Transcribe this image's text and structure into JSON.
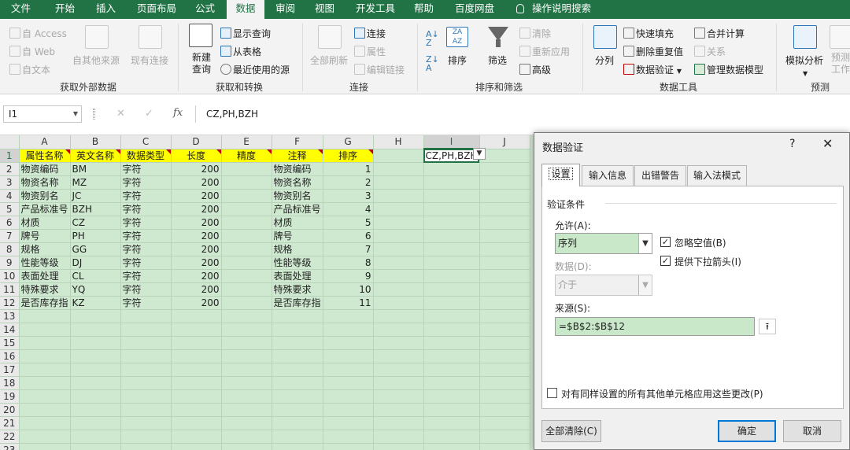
{
  "tabs": [
    "文件",
    "开始",
    "插入",
    "页面布局",
    "公式",
    "数据",
    "审阅",
    "视图",
    "开发工具",
    "帮助",
    "百度网盘",
    "操作说明搜索"
  ],
  "ribbon": {
    "groups": {
      "external": {
        "label": "获取外部数据",
        "items": [
          "自 Access",
          "自 Web",
          "自文本"
        ],
        "other_sources": "自其他来源",
        "existing": "现有连接"
      },
      "transform": {
        "label": "获取和转换",
        "new_query": "新建\n查询",
        "new_query_l1": "新建",
        "new_query_l2": "查询",
        "items": [
          "显示查询",
          "从表格",
          "最近使用的源"
        ]
      },
      "connections": {
        "label": "连接",
        "refresh_all": "全部刷新",
        "items": [
          "连接",
          "属性",
          "编辑链接"
        ]
      },
      "sort_filter": {
        "label": "排序和筛选",
        "sort": "排序",
        "filter": "筛选",
        "items": [
          "清除",
          "重新应用",
          "高级"
        ]
      },
      "data_tools": {
        "label": "数据工具",
        "split": "分列",
        "items": [
          "快速填充",
          "删除重复值",
          "数据验证",
          "合并计算",
          "关系",
          "管理数据模型"
        ]
      },
      "forecast": {
        "label": "预测",
        "what_if": "模拟分析",
        "forecast_sheet": "预测\n工作表",
        "forecast_l1": "预测",
        "forecast_l2": "工作表"
      }
    }
  },
  "formula_bar": {
    "name_box": "I1",
    "fx": "fx",
    "cancel": "✕",
    "enter": "✓",
    "value": "CZ,PH,BZH"
  },
  "sheet": {
    "columns": [
      "A",
      "B",
      "C",
      "D",
      "E",
      "F",
      "G",
      "H",
      "I",
      "J"
    ],
    "header_row": [
      "属性名称",
      "英文名称",
      "数据类型",
      "长度",
      "精度",
      "注释",
      "排序"
    ],
    "rows": [
      [
        "物资编码",
        "BM",
        "字符",
        "200",
        "",
        "物资编码",
        "1"
      ],
      [
        "物资名称",
        "MZ",
        "字符",
        "200",
        "",
        "物资名称",
        "2"
      ],
      [
        "物资别名",
        "JC",
        "字符",
        "200",
        "",
        "物资别名",
        "3"
      ],
      [
        "产品标准号",
        "BZH",
        "字符",
        "200",
        "",
        "产品标准号",
        "4"
      ],
      [
        "材质",
        "CZ",
        "字符",
        "200",
        "",
        "材质",
        "5"
      ],
      [
        "牌号",
        "PH",
        "字符",
        "200",
        "",
        "牌号",
        "6"
      ],
      [
        "规格",
        "GG",
        "字符",
        "200",
        "",
        "规格",
        "7"
      ],
      [
        "性能等级",
        "DJ",
        "字符",
        "200",
        "",
        "性能等级",
        "8"
      ],
      [
        "表面处理",
        "CL",
        "字符",
        "200",
        "",
        "表面处理",
        "9"
      ],
      [
        "特殊要求",
        "YQ",
        "字符",
        "200",
        "",
        "特殊要求",
        "10"
      ],
      [
        "是否库存指",
        "KZ",
        "字符",
        "200",
        "",
        "是否库存指",
        "11"
      ]
    ],
    "row_numbers": [
      "1",
      "2",
      "3",
      "4",
      "5",
      "6",
      "7",
      "8",
      "9",
      "10",
      "11",
      "12",
      "13",
      "14",
      "15",
      "16",
      "17",
      "18",
      "19",
      "20",
      "21",
      "22",
      "23"
    ],
    "active_cell_value": "CZ,PH,BZH",
    "header_fill": "#ffff00",
    "cell_fill": "#cfe8d0"
  },
  "dialog": {
    "title": "数据验证",
    "help": "?",
    "close": "✕",
    "tabs": [
      "设置",
      "输入信息",
      "出错警告",
      "输入法模式"
    ],
    "section": "验证条件",
    "allow_label": "允许(A):",
    "allow_value": "序列",
    "ignore_blank": "忽略空值(B)",
    "dropdown_arrow": "提供下拉箭头(I)",
    "data_label": "数据(D):",
    "data_value": "介于",
    "source_label": "来源(S):",
    "source_value": "=$B$2:$B$12",
    "apply_all": "对有同样设置的所有其他单元格应用这些更改(P)",
    "clear_all": "全部清除(C)",
    "ok": "确定",
    "cancel": "取消"
  }
}
